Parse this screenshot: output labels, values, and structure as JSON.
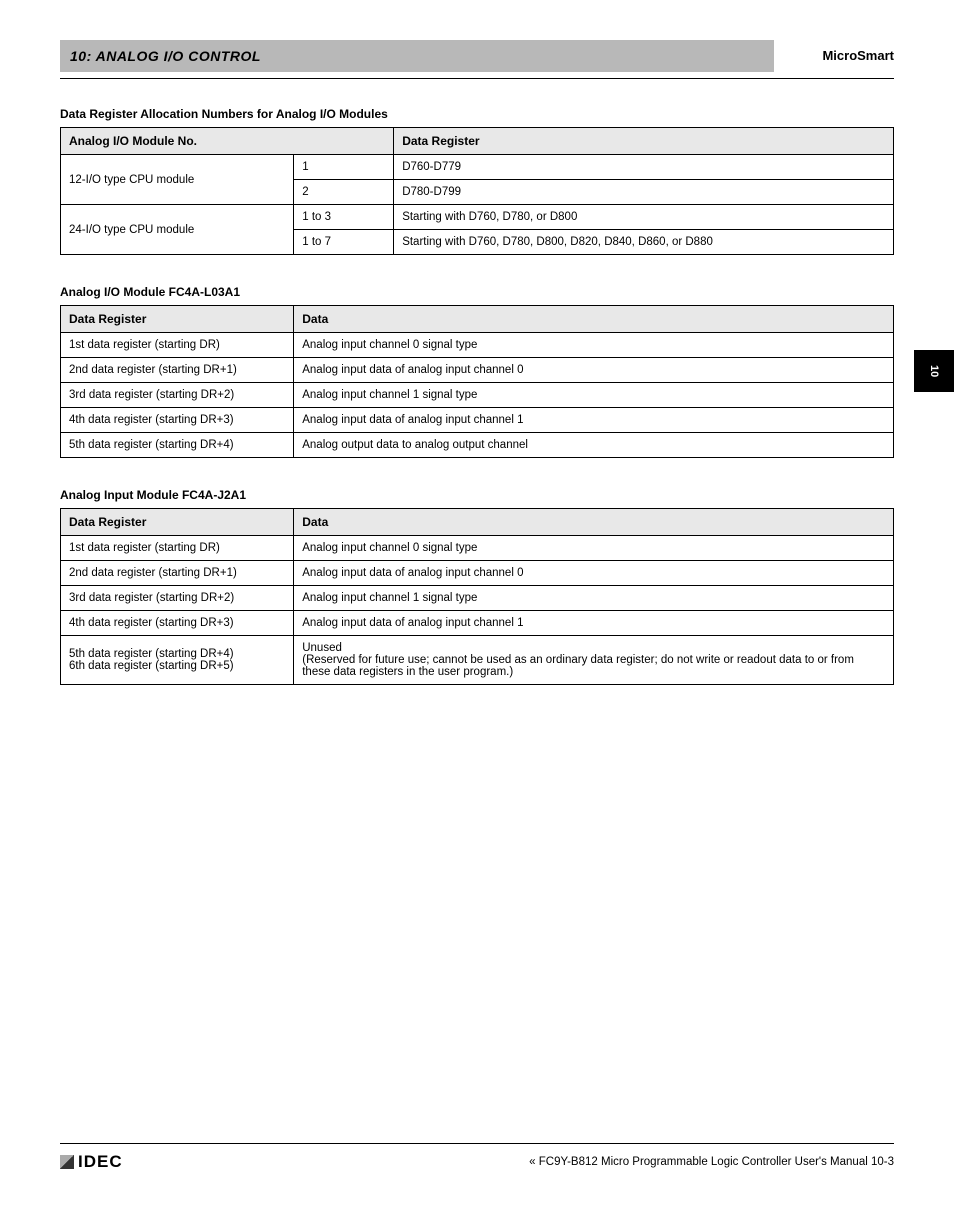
{
  "header": {
    "title": "10: ANALOG I/O CONTROL",
    "right": "MicroSmart"
  },
  "tab": "10",
  "sections": [
    {
      "heading": "Data Register Allocation Numbers for Analog I/O Modules",
      "type": "t1",
      "thead": [
        "Analog I/O Module No.",
        "",
        "Data Register"
      ],
      "rows": [
        [
          "12-I/O type CPU module",
          "1",
          "D760-D779"
        ],
        [
          "",
          "2",
          "D780-D799"
        ],
        [
          "24-I/O type CPU module",
          "1 to 3",
          "Starting with D760, D780, or D800"
        ],
        [
          "",
          "1 to 7",
          "Starting with D760, D780, D800, D820, D840, D860, or D880"
        ]
      ]
    },
    {
      "heading": "Analog I/O Module FC4A-L03A1",
      "type": "t2",
      "thead": [
        "Data Register",
        "Data"
      ],
      "rows": [
        [
          "1st data register (starting DR)",
          "Analog input channel 0 signal type"
        ],
        [
          "2nd data register (starting DR+1)",
          "Analog input data of analog input channel 0"
        ],
        [
          "3rd data register (starting DR+2)",
          "Analog input channel 1 signal type"
        ],
        [
          "4th data register (starting DR+3)",
          "Analog input data of analog input channel 1"
        ],
        [
          "5th data register (starting DR+4)",
          "Analog output data to analog output channel"
        ]
      ]
    },
    {
      "heading": "Analog Input Module FC4A-J2A1",
      "type": "t2",
      "thead": [
        "Data Register",
        "Data"
      ],
      "rows": [
        [
          "1st data register (starting DR)",
          "Analog input channel 0 signal type"
        ],
        [
          "2nd data register (starting DR+1)",
          "Analog input data of analog input channel 0"
        ],
        [
          "3rd data register (starting DR+2)",
          "Analog input channel 1 signal type"
        ],
        [
          "4th data register (starting DR+3)",
          "Analog input data of analog input channel 1"
        ],
        [
          "5th data register (starting DR+4)\n6th data register (starting DR+5)",
          "Unused\n(Reserved for future use; cannot be used as an ordinary data register; do not write or readout data to or from these data registers in the user program.)"
        ]
      ]
    }
  ],
  "footer": {
    "logo_text": "IDEC",
    "right": "« FC9Y-B812   Micro Programmable Logic Controller User's Manual    10-3"
  }
}
